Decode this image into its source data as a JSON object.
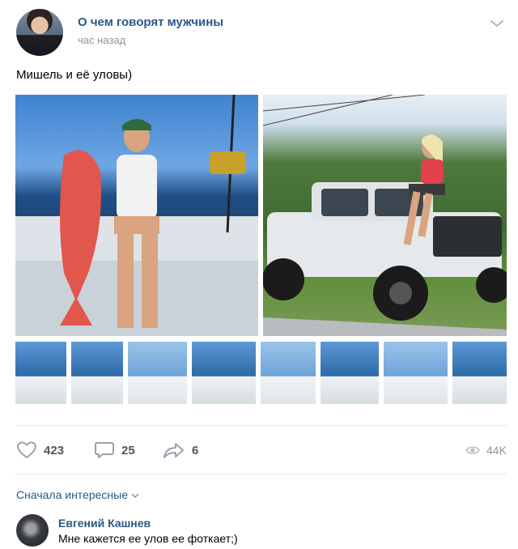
{
  "post": {
    "group_name": "О чем говорят мужчины",
    "time": "час назад",
    "text": "Мишель и её уловы)"
  },
  "actions": {
    "likes": "423",
    "comments": "25",
    "shares": "6",
    "views": "44K"
  },
  "icons": {
    "like": "heart-icon",
    "comment": "speech-bubble-icon",
    "share": "share-arrow-icon",
    "views": "eye-icon",
    "menu": "chevron-down-icon"
  },
  "comments": {
    "sort_label": "Сначала интересные",
    "items": [
      {
        "author": "Евгений Кашнев",
        "text": "Мне кажется ее улов ее фоткает;)"
      }
    ]
  },
  "colors": {
    "link": "#2a5885",
    "muted": "#939393",
    "icon": "#99a2ad"
  }
}
